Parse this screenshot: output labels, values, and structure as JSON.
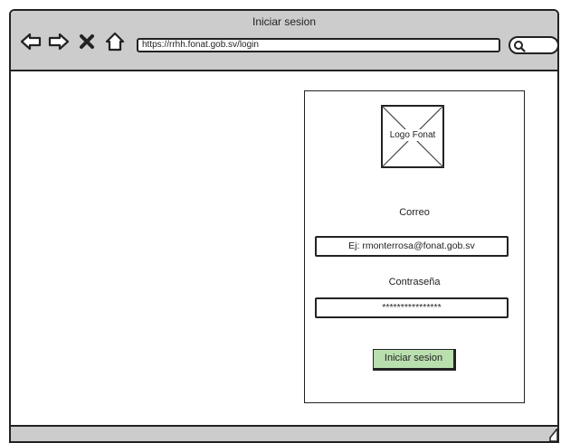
{
  "window": {
    "title": "Iniciar sesion"
  },
  "toolbar": {
    "back_icon": "arrow-left-icon",
    "forward_icon": "arrow-right-icon",
    "close_icon": "close-x-icon",
    "home_icon": "home-icon",
    "address": "https://rrhh.fonat.gob.sv/login",
    "search_icon": "search-icon"
  },
  "login": {
    "logo_label": "Logo Fonat",
    "email_label": "Correo",
    "email_value": "Ej: rmonterrosa@fonat.gob.sv",
    "password_label": "Contraseña",
    "password_value": "****************",
    "submit_label": "Iniciar sesion"
  },
  "colors": {
    "chrome": "#cccccc",
    "button": "#b9dfae",
    "stroke": "#222222"
  }
}
